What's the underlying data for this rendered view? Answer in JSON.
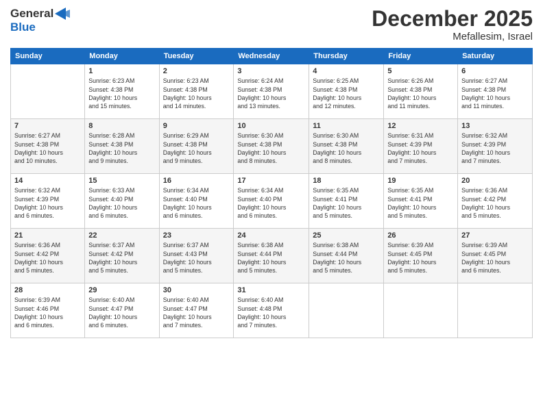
{
  "logo": {
    "line1": "General",
    "line2": "Blue"
  },
  "title": "December 2025",
  "location": "Mefallesim, Israel",
  "days_header": [
    "Sunday",
    "Monday",
    "Tuesday",
    "Wednesday",
    "Thursday",
    "Friday",
    "Saturday"
  ],
  "weeks": [
    [
      {
        "day": "",
        "info": ""
      },
      {
        "day": "1",
        "info": "Sunrise: 6:23 AM\nSunset: 4:38 PM\nDaylight: 10 hours\nand 15 minutes."
      },
      {
        "day": "2",
        "info": "Sunrise: 6:23 AM\nSunset: 4:38 PM\nDaylight: 10 hours\nand 14 minutes."
      },
      {
        "day": "3",
        "info": "Sunrise: 6:24 AM\nSunset: 4:38 PM\nDaylight: 10 hours\nand 13 minutes."
      },
      {
        "day": "4",
        "info": "Sunrise: 6:25 AM\nSunset: 4:38 PM\nDaylight: 10 hours\nand 12 minutes."
      },
      {
        "day": "5",
        "info": "Sunrise: 6:26 AM\nSunset: 4:38 PM\nDaylight: 10 hours\nand 11 minutes."
      },
      {
        "day": "6",
        "info": "Sunrise: 6:27 AM\nSunset: 4:38 PM\nDaylight: 10 hours\nand 11 minutes."
      }
    ],
    [
      {
        "day": "7",
        "info": "Sunrise: 6:27 AM\nSunset: 4:38 PM\nDaylight: 10 hours\nand 10 minutes."
      },
      {
        "day": "8",
        "info": "Sunrise: 6:28 AM\nSunset: 4:38 PM\nDaylight: 10 hours\nand 9 minutes."
      },
      {
        "day": "9",
        "info": "Sunrise: 6:29 AM\nSunset: 4:38 PM\nDaylight: 10 hours\nand 9 minutes."
      },
      {
        "day": "10",
        "info": "Sunrise: 6:30 AM\nSunset: 4:38 PM\nDaylight: 10 hours\nand 8 minutes."
      },
      {
        "day": "11",
        "info": "Sunrise: 6:30 AM\nSunset: 4:38 PM\nDaylight: 10 hours\nand 8 minutes."
      },
      {
        "day": "12",
        "info": "Sunrise: 6:31 AM\nSunset: 4:39 PM\nDaylight: 10 hours\nand 7 minutes."
      },
      {
        "day": "13",
        "info": "Sunrise: 6:32 AM\nSunset: 4:39 PM\nDaylight: 10 hours\nand 7 minutes."
      }
    ],
    [
      {
        "day": "14",
        "info": "Sunrise: 6:32 AM\nSunset: 4:39 PM\nDaylight: 10 hours\nand 6 minutes."
      },
      {
        "day": "15",
        "info": "Sunrise: 6:33 AM\nSunset: 4:40 PM\nDaylight: 10 hours\nand 6 minutes."
      },
      {
        "day": "16",
        "info": "Sunrise: 6:34 AM\nSunset: 4:40 PM\nDaylight: 10 hours\nand 6 minutes."
      },
      {
        "day": "17",
        "info": "Sunrise: 6:34 AM\nSunset: 4:40 PM\nDaylight: 10 hours\nand 6 minutes."
      },
      {
        "day": "18",
        "info": "Sunrise: 6:35 AM\nSunset: 4:41 PM\nDaylight: 10 hours\nand 5 minutes."
      },
      {
        "day": "19",
        "info": "Sunrise: 6:35 AM\nSunset: 4:41 PM\nDaylight: 10 hours\nand 5 minutes."
      },
      {
        "day": "20",
        "info": "Sunrise: 6:36 AM\nSunset: 4:42 PM\nDaylight: 10 hours\nand 5 minutes."
      }
    ],
    [
      {
        "day": "21",
        "info": "Sunrise: 6:36 AM\nSunset: 4:42 PM\nDaylight: 10 hours\nand 5 minutes."
      },
      {
        "day": "22",
        "info": "Sunrise: 6:37 AM\nSunset: 4:42 PM\nDaylight: 10 hours\nand 5 minutes."
      },
      {
        "day": "23",
        "info": "Sunrise: 6:37 AM\nSunset: 4:43 PM\nDaylight: 10 hours\nand 5 minutes."
      },
      {
        "day": "24",
        "info": "Sunrise: 6:38 AM\nSunset: 4:44 PM\nDaylight: 10 hours\nand 5 minutes."
      },
      {
        "day": "25",
        "info": "Sunrise: 6:38 AM\nSunset: 4:44 PM\nDaylight: 10 hours\nand 5 minutes."
      },
      {
        "day": "26",
        "info": "Sunrise: 6:39 AM\nSunset: 4:45 PM\nDaylight: 10 hours\nand 5 minutes."
      },
      {
        "day": "27",
        "info": "Sunrise: 6:39 AM\nSunset: 4:45 PM\nDaylight: 10 hours\nand 6 minutes."
      }
    ],
    [
      {
        "day": "28",
        "info": "Sunrise: 6:39 AM\nSunset: 4:46 PM\nDaylight: 10 hours\nand 6 minutes."
      },
      {
        "day": "29",
        "info": "Sunrise: 6:40 AM\nSunset: 4:47 PM\nDaylight: 10 hours\nand 6 minutes."
      },
      {
        "day": "30",
        "info": "Sunrise: 6:40 AM\nSunset: 4:47 PM\nDaylight: 10 hours\nand 7 minutes."
      },
      {
        "day": "31",
        "info": "Sunrise: 6:40 AM\nSunset: 4:48 PM\nDaylight: 10 hours\nand 7 minutes."
      },
      {
        "day": "",
        "info": ""
      },
      {
        "day": "",
        "info": ""
      },
      {
        "day": "",
        "info": ""
      }
    ]
  ]
}
